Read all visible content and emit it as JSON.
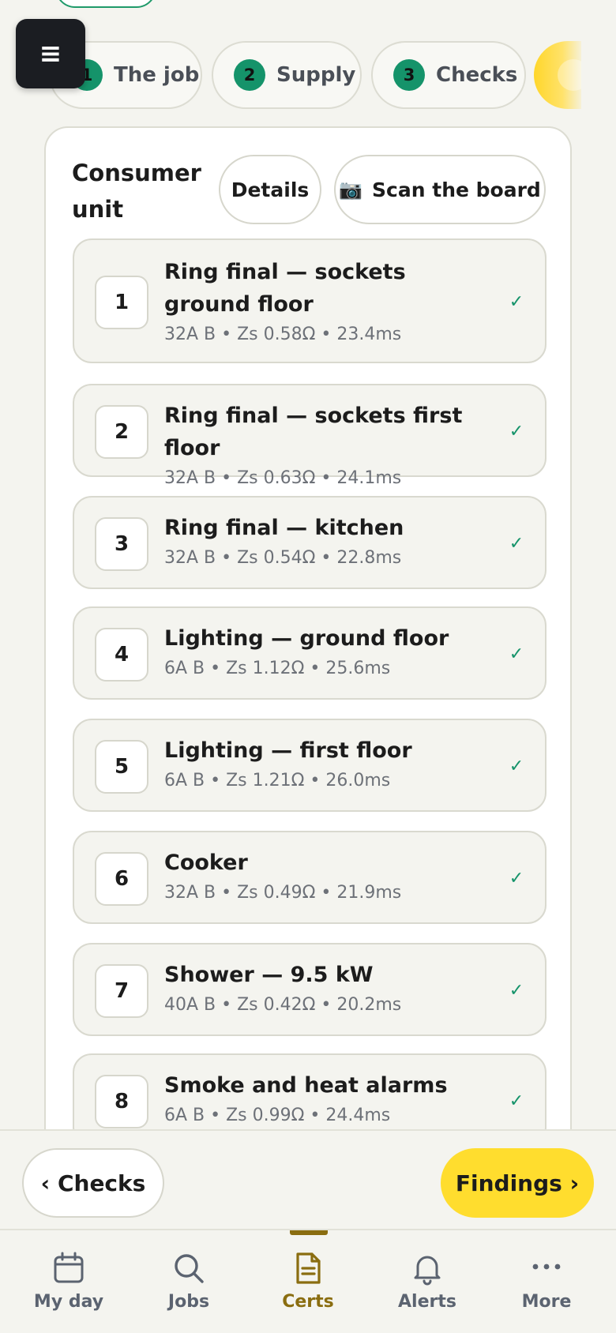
{
  "steps": [
    {
      "num": "1",
      "label": "The job"
    },
    {
      "num": "2",
      "label": "Supply"
    },
    {
      "num": "3",
      "label": "Checks"
    }
  ],
  "menu": {
    "glyph": "≡"
  },
  "card": {
    "title": "Consumer unit",
    "details_label": "Details",
    "scan_icon": "📷",
    "scan_label": "Scan the board"
  },
  "circuits": [
    {
      "num": "1",
      "name": "Ring final — sockets ground floor",
      "meta": "32A B • Zs 0.58Ω • 23.4ms",
      "check": "✓"
    },
    {
      "num": "2",
      "name": "Ring final — sockets first floor",
      "meta": "32A B • Zs 0.63Ω • 24.1ms",
      "check": "✓"
    },
    {
      "num": "3",
      "name": "Ring final — kitchen",
      "meta": "32A B • Zs 0.54Ω • 22.8ms",
      "check": "✓"
    },
    {
      "num": "4",
      "name": "Lighting — ground floor",
      "meta": "6A B • Zs 1.12Ω • 25.6ms",
      "check": "✓"
    },
    {
      "num": "5",
      "name": "Lighting — first floor",
      "meta": "6A B • Zs 1.21Ω • 26.0ms",
      "check": "✓"
    },
    {
      "num": "6",
      "name": "Cooker",
      "meta": "32A B • Zs 0.49Ω • 21.9ms",
      "check": "✓"
    },
    {
      "num": "7",
      "name": "Shower — 9.5 kW",
      "meta": "40A B • Zs 0.42Ω • 20.2ms",
      "check": "✓"
    },
    {
      "num": "8",
      "name": "Smoke and heat alarms",
      "meta": "6A B • Zs 0.99Ω • 24.4ms",
      "check": "✓"
    }
  ],
  "actions": {
    "back_label": "‹ Checks",
    "next_label": "Findings ›"
  },
  "tabbar": [
    {
      "label": "My day",
      "icon": "calendar-icon"
    },
    {
      "label": "Jobs",
      "icon": "search-icon"
    },
    {
      "label": "Certs",
      "icon": "document-icon"
    },
    {
      "label": "Alerts",
      "icon": "bell-icon"
    },
    {
      "label": "More",
      "icon": "more-icon"
    }
  ],
  "colors": {
    "accent_green": "#15936a",
    "accent_yellow": "#ffdd2e",
    "active_tab": "#8a6d10"
  }
}
